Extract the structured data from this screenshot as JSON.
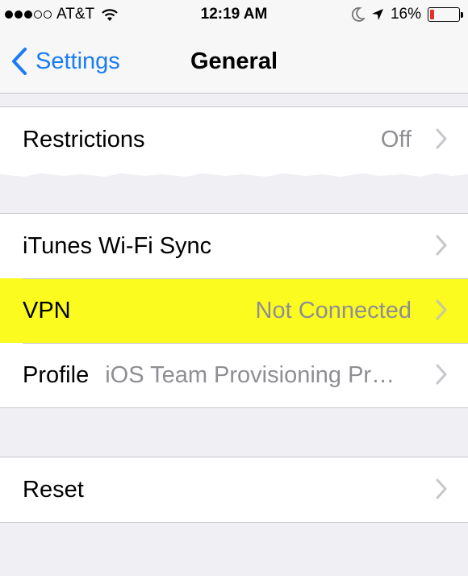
{
  "status_bar": {
    "signal_bars_filled": 3,
    "signal_bars_total": 5,
    "carrier": "AT&T",
    "wifi_icon": "wifi-icon",
    "time": "12:19 AM",
    "dnd_icon": "moon-icon",
    "location_icon": "location-arrow-icon",
    "battery_percent": "16%",
    "battery_level": 0.16,
    "battery_color": "#e5302a"
  },
  "nav": {
    "back_label": "Settings",
    "title": "General",
    "accent_color": "#1a7cf5"
  },
  "rows": {
    "restrictions": {
      "label": "Restrictions",
      "value": "Off"
    },
    "itunes": {
      "label": "iTunes Wi-Fi Sync",
      "value": ""
    },
    "vpn": {
      "label": "VPN",
      "value": "Not Connected",
      "highlight_color": "#fbfb1f"
    },
    "profile": {
      "label": "Profile",
      "value": "iOS Team Provisioning Pr…"
    },
    "reset": {
      "label": "Reset",
      "value": ""
    }
  }
}
